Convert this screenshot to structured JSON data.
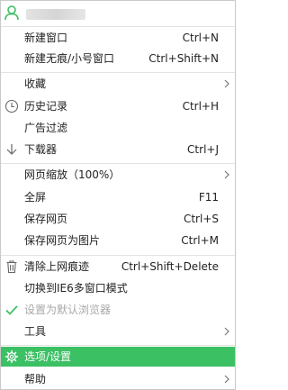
{
  "colors": {
    "accent": "#3cc064",
    "check": "#3cc064",
    "separator": "#e3e3e3"
  },
  "menu": {
    "new_window": {
      "label": "新建窗口",
      "shortcut": "Ctrl+N"
    },
    "new_private": {
      "label": "新建无痕/小号窗口",
      "shortcut": "Ctrl+Shift+N"
    },
    "favorites": {
      "label": "收藏"
    },
    "history": {
      "label": "历史记录",
      "shortcut": "Ctrl+H",
      "icon": "clock-icon"
    },
    "ad_filter": {
      "label": "广告过滤"
    },
    "downloads": {
      "label": "下载器",
      "shortcut": "Ctrl+J",
      "icon": "download-icon"
    },
    "zoom": {
      "label": "网页缩放（100%）"
    },
    "fullscreen": {
      "label": "全屏",
      "shortcut": "F11"
    },
    "save_page": {
      "label": "保存网页",
      "shortcut": "Ctrl+S"
    },
    "save_as_image": {
      "label": "保存网页为图片",
      "shortcut": "Ctrl+M"
    },
    "clear_traces": {
      "label": "清除上网痕迹",
      "shortcut": "Ctrl+Shift+Delete",
      "icon": "trash-icon"
    },
    "ie6_mode": {
      "label": "切换到IE6多窗口模式"
    },
    "set_default": {
      "label": "设置为默认浏览器",
      "icon": "checkmark-icon",
      "disabled": true
    },
    "tools": {
      "label": "工具"
    },
    "options": {
      "label": "选项/设置",
      "icon": "gear-icon",
      "highlighted": true
    },
    "help": {
      "label": "帮助"
    }
  }
}
